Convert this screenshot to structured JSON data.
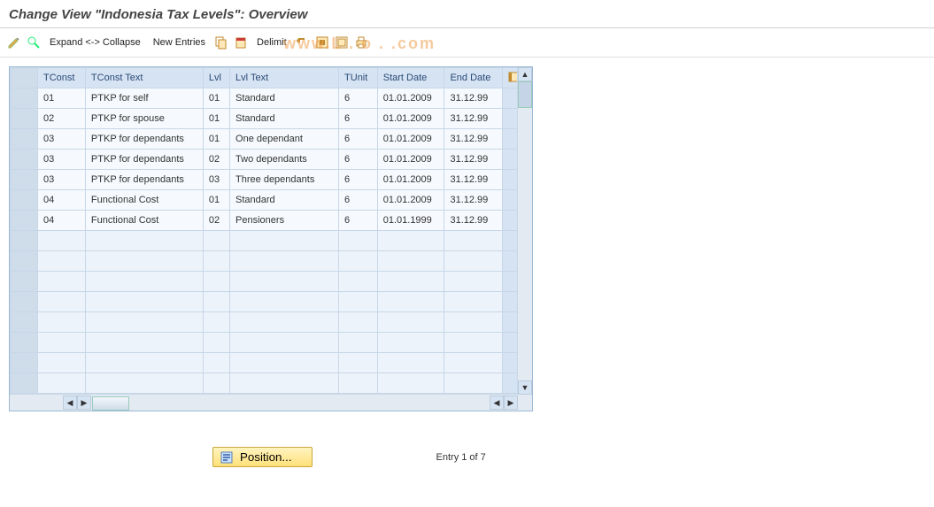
{
  "title": "Change View \"Indonesia Tax Levels\": Overview",
  "watermark": "www.L . o . .com",
  "toolbar": {
    "expand": "Expand <-> Collapse",
    "new_entries": "New Entries",
    "delimit": "Delimit"
  },
  "columns": {
    "tconst": "TConst",
    "tconst_text": "TConst Text",
    "lvl": "Lvl",
    "lvl_text": "Lvl Text",
    "tunit": "TUnit",
    "start": "Start Date",
    "end": "End Date"
  },
  "rows": [
    {
      "tconst": "01",
      "tconst_text": "PTKP for self",
      "lvl": "01",
      "lvl_text": "Standard",
      "tunit": "6",
      "start": "01.01.2009",
      "end": "31.12.99"
    },
    {
      "tconst": "02",
      "tconst_text": "PTKP for spouse",
      "lvl": "01",
      "lvl_text": "Standard",
      "tunit": "6",
      "start": "01.01.2009",
      "end": "31.12.99"
    },
    {
      "tconst": "03",
      "tconst_text": "PTKP for dependants",
      "lvl": "01",
      "lvl_text": "One dependant",
      "tunit": "6",
      "start": "01.01.2009",
      "end": "31.12.99"
    },
    {
      "tconst": "03",
      "tconst_text": "PTKP for dependants",
      "lvl": "02",
      "lvl_text": "Two dependants",
      "tunit": "6",
      "start": "01.01.2009",
      "end": "31.12.99"
    },
    {
      "tconst": "03",
      "tconst_text": "PTKP for dependants",
      "lvl": "03",
      "lvl_text": "Three dependants",
      "tunit": "6",
      "start": "01.01.2009",
      "end": "31.12.99"
    },
    {
      "tconst": "04",
      "tconst_text": "Functional Cost",
      "lvl": "01",
      "lvl_text": "Standard",
      "tunit": "6",
      "start": "01.01.2009",
      "end": "31.12.99"
    },
    {
      "tconst": "04",
      "tconst_text": "Functional Cost",
      "lvl": "02",
      "lvl_text": "Pensioners",
      "tunit": "6",
      "start": "01.01.1999",
      "end": "31.12.99"
    }
  ],
  "empty_rows": 8,
  "position_btn": "Position...",
  "entry_counter": "Entry 1 of 7"
}
